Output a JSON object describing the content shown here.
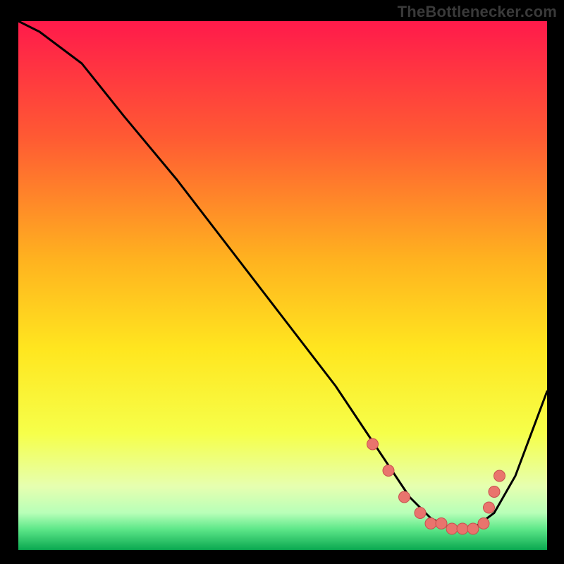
{
  "attribution": "TheBottlenecker.com",
  "palette": {
    "frame_bg": "#000000",
    "gradient_top": "#ff1a4b",
    "gradient_mid_upper": "#ff7a2a",
    "gradient_mid": "#ffd21f",
    "gradient_mid_lower": "#f6ff4a",
    "gradient_pale": "#eaffd0",
    "gradient_green": "#1fe06a",
    "gradient_bottom": "#0aa850",
    "curve_stroke": "#000000",
    "dot_fill": "#e9746d",
    "dot_stroke": "#c94f4f"
  },
  "chart_data": {
    "type": "line",
    "title": "",
    "xlabel": "",
    "ylabel": "",
    "xlim": [
      0,
      100
    ],
    "ylim": [
      0,
      100
    ],
    "grid": false,
    "legend": false,
    "series": [
      {
        "name": "bottleneck-curve",
        "x": [
          0,
          4,
          8,
          12,
          20,
          30,
          40,
          50,
          60,
          66,
          70,
          74,
          78,
          82,
          86,
          90,
          94,
          100
        ],
        "y": [
          100,
          98,
          95,
          92,
          82,
          70,
          57,
          44,
          31,
          22,
          16,
          10,
          6,
          4,
          4,
          7,
          14,
          30
        ]
      }
    ],
    "dots": {
      "name": "highlight-dots",
      "x": [
        67,
        70,
        73,
        76,
        78,
        80,
        82,
        84,
        86,
        88,
        89,
        90,
        91
      ],
      "y": [
        20,
        15,
        10,
        7,
        5,
        5,
        4,
        4,
        4,
        5,
        8,
        11,
        14
      ]
    }
  }
}
